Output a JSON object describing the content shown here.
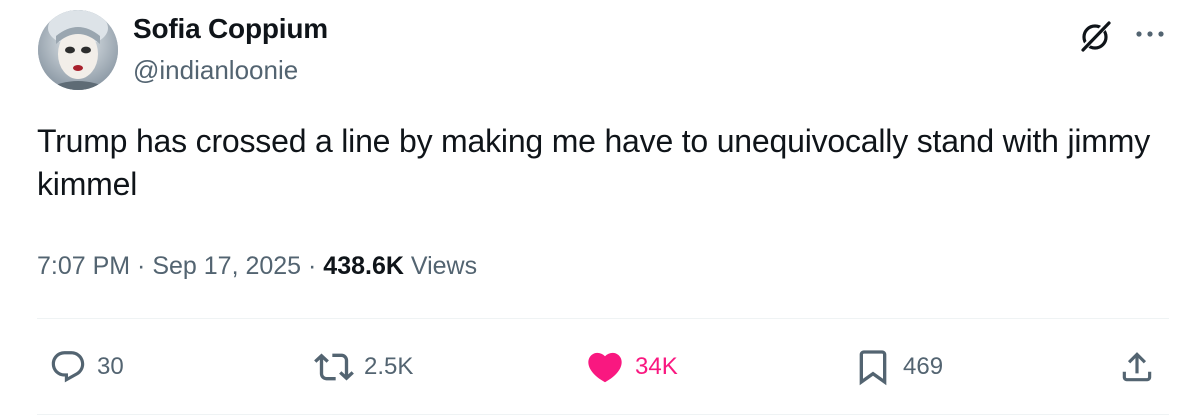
{
  "author": {
    "display_name": "Sofia Coppium",
    "handle": "@indianloonie",
    "avatar": "profile-photo"
  },
  "tweet": {
    "text": "Trump has crossed a line by making me have to unequivocally stand with jimmy kimmel"
  },
  "meta": {
    "time": "7:07 PM",
    "separator": " · ",
    "date": "Sep 17, 2025",
    "views_count": "438.6K",
    "views_label": "Views"
  },
  "actions": {
    "replies": "30",
    "reposts": "2.5K",
    "likes": "34K",
    "bookmarks": "469"
  },
  "icons": {
    "grok": "grok-icon",
    "more": "more-icon",
    "reply": "reply-icon",
    "repost": "repost-icon",
    "like": "heart-icon",
    "bookmark": "bookmark-icon",
    "share": "share-icon"
  },
  "colors": {
    "text_primary": "#0f1419",
    "text_secondary": "#536471",
    "like_active": "#f91880",
    "divider": "#eff3f4"
  }
}
